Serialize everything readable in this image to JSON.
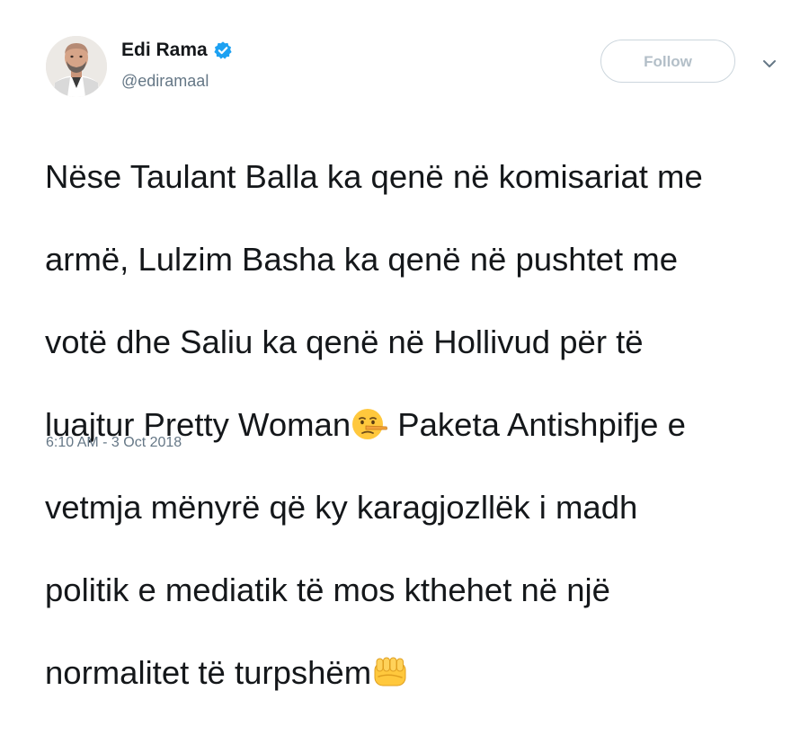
{
  "author": {
    "display_name": "Edi Rama",
    "handle": "@ediramaal",
    "verified": true,
    "avatar_icon": "profile-photo"
  },
  "actions": {
    "follow_label": "Follow",
    "more_icon": "chevron-down-icon"
  },
  "tweet": {
    "lines": [
      "Nëse Taulant Balla ka qenë në komisariat me",
      "armë, Lulzim Basha ka qenë në pushtet me",
      "votë dhe Saliu ka qenë në Hollivud për të",
      "luajtur Pretty Woman",
      " Paketa Antishpifje e",
      "vetmja mënyrë që ky karagjozllëk i madh",
      "politik e mediatik të mos kthehet në një",
      "normalitet të turpshëm"
    ],
    "emojis": [
      "lying-face-emoji",
      "oncoming-fist-emoji"
    ],
    "timestamp": "6:10 AM - 3 Oct 2018"
  },
  "colors": {
    "verified_blue": "#1da1f2",
    "text": "#14171a",
    "muted": "#657786",
    "button_border": "#ccd6dd",
    "emoji_yellow": "#ffc83d"
  }
}
